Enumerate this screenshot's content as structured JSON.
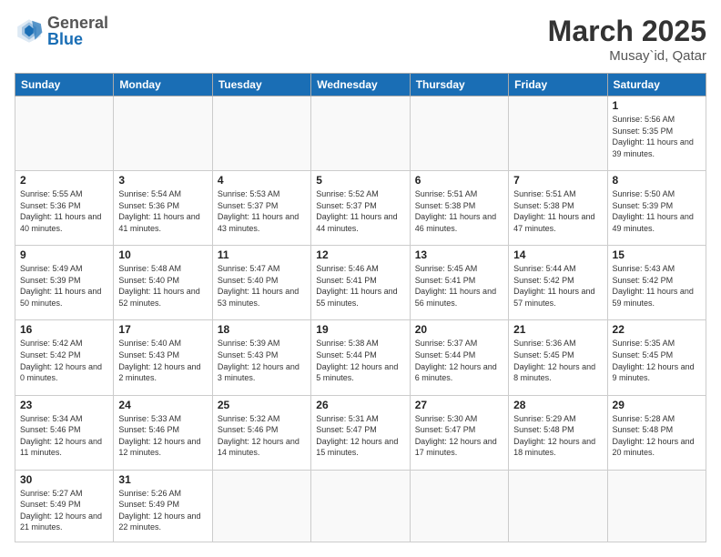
{
  "header": {
    "logo_general": "General",
    "logo_blue": "Blue",
    "title": "March 2025",
    "subtitle": "Musay`id, Qatar"
  },
  "days_of_week": [
    "Sunday",
    "Monday",
    "Tuesday",
    "Wednesday",
    "Thursday",
    "Friday",
    "Saturday"
  ],
  "weeks": [
    [
      {
        "day": "",
        "info": ""
      },
      {
        "day": "",
        "info": ""
      },
      {
        "day": "",
        "info": ""
      },
      {
        "day": "",
        "info": ""
      },
      {
        "day": "",
        "info": ""
      },
      {
        "day": "",
        "info": ""
      },
      {
        "day": "1",
        "info": "Sunrise: 5:56 AM\nSunset: 5:35 PM\nDaylight: 11 hours and 39 minutes."
      }
    ],
    [
      {
        "day": "2",
        "info": "Sunrise: 5:55 AM\nSunset: 5:36 PM\nDaylight: 11 hours and 40 minutes."
      },
      {
        "day": "3",
        "info": "Sunrise: 5:54 AM\nSunset: 5:36 PM\nDaylight: 11 hours and 41 minutes."
      },
      {
        "day": "4",
        "info": "Sunrise: 5:53 AM\nSunset: 5:37 PM\nDaylight: 11 hours and 43 minutes."
      },
      {
        "day": "5",
        "info": "Sunrise: 5:52 AM\nSunset: 5:37 PM\nDaylight: 11 hours and 44 minutes."
      },
      {
        "day": "6",
        "info": "Sunrise: 5:51 AM\nSunset: 5:38 PM\nDaylight: 11 hours and 46 minutes."
      },
      {
        "day": "7",
        "info": "Sunrise: 5:51 AM\nSunset: 5:38 PM\nDaylight: 11 hours and 47 minutes."
      },
      {
        "day": "8",
        "info": "Sunrise: 5:50 AM\nSunset: 5:39 PM\nDaylight: 11 hours and 49 minutes."
      }
    ],
    [
      {
        "day": "9",
        "info": "Sunrise: 5:49 AM\nSunset: 5:39 PM\nDaylight: 11 hours and 50 minutes."
      },
      {
        "day": "10",
        "info": "Sunrise: 5:48 AM\nSunset: 5:40 PM\nDaylight: 11 hours and 52 minutes."
      },
      {
        "day": "11",
        "info": "Sunrise: 5:47 AM\nSunset: 5:40 PM\nDaylight: 11 hours and 53 minutes."
      },
      {
        "day": "12",
        "info": "Sunrise: 5:46 AM\nSunset: 5:41 PM\nDaylight: 11 hours and 55 minutes."
      },
      {
        "day": "13",
        "info": "Sunrise: 5:45 AM\nSunset: 5:41 PM\nDaylight: 11 hours and 56 minutes."
      },
      {
        "day": "14",
        "info": "Sunrise: 5:44 AM\nSunset: 5:42 PM\nDaylight: 11 hours and 57 minutes."
      },
      {
        "day": "15",
        "info": "Sunrise: 5:43 AM\nSunset: 5:42 PM\nDaylight: 11 hours and 59 minutes."
      }
    ],
    [
      {
        "day": "16",
        "info": "Sunrise: 5:42 AM\nSunset: 5:42 PM\nDaylight: 12 hours and 0 minutes."
      },
      {
        "day": "17",
        "info": "Sunrise: 5:40 AM\nSunset: 5:43 PM\nDaylight: 12 hours and 2 minutes."
      },
      {
        "day": "18",
        "info": "Sunrise: 5:39 AM\nSunset: 5:43 PM\nDaylight: 12 hours and 3 minutes."
      },
      {
        "day": "19",
        "info": "Sunrise: 5:38 AM\nSunset: 5:44 PM\nDaylight: 12 hours and 5 minutes."
      },
      {
        "day": "20",
        "info": "Sunrise: 5:37 AM\nSunset: 5:44 PM\nDaylight: 12 hours and 6 minutes."
      },
      {
        "day": "21",
        "info": "Sunrise: 5:36 AM\nSunset: 5:45 PM\nDaylight: 12 hours and 8 minutes."
      },
      {
        "day": "22",
        "info": "Sunrise: 5:35 AM\nSunset: 5:45 PM\nDaylight: 12 hours and 9 minutes."
      }
    ],
    [
      {
        "day": "23",
        "info": "Sunrise: 5:34 AM\nSunset: 5:46 PM\nDaylight: 12 hours and 11 minutes."
      },
      {
        "day": "24",
        "info": "Sunrise: 5:33 AM\nSunset: 5:46 PM\nDaylight: 12 hours and 12 minutes."
      },
      {
        "day": "25",
        "info": "Sunrise: 5:32 AM\nSunset: 5:46 PM\nDaylight: 12 hours and 14 minutes."
      },
      {
        "day": "26",
        "info": "Sunrise: 5:31 AM\nSunset: 5:47 PM\nDaylight: 12 hours and 15 minutes."
      },
      {
        "day": "27",
        "info": "Sunrise: 5:30 AM\nSunset: 5:47 PM\nDaylight: 12 hours and 17 minutes."
      },
      {
        "day": "28",
        "info": "Sunrise: 5:29 AM\nSunset: 5:48 PM\nDaylight: 12 hours and 18 minutes."
      },
      {
        "day": "29",
        "info": "Sunrise: 5:28 AM\nSunset: 5:48 PM\nDaylight: 12 hours and 20 minutes."
      }
    ],
    [
      {
        "day": "30",
        "info": "Sunrise: 5:27 AM\nSunset: 5:49 PM\nDaylight: 12 hours and 21 minutes."
      },
      {
        "day": "31",
        "info": "Sunrise: 5:26 AM\nSunset: 5:49 PM\nDaylight: 12 hours and 22 minutes."
      },
      {
        "day": "",
        "info": ""
      },
      {
        "day": "",
        "info": ""
      },
      {
        "day": "",
        "info": ""
      },
      {
        "day": "",
        "info": ""
      },
      {
        "day": "",
        "info": ""
      }
    ]
  ]
}
